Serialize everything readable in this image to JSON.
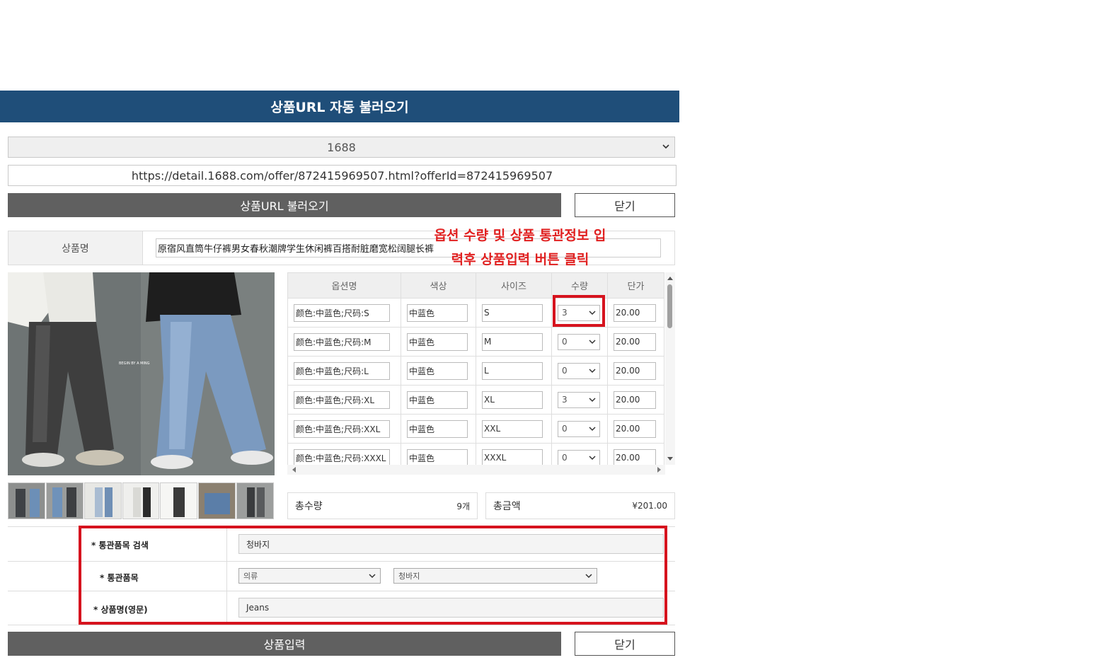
{
  "header": {
    "title": "상품URL 자동 불러오기"
  },
  "site_select": {
    "value": "1688"
  },
  "url_input": {
    "value": "https://detail.1688.com/offer/872415969507.html?offerId=872415969507"
  },
  "buttons": {
    "load": "상품URL 불러오기",
    "close": "닫기",
    "submit": "상품입력"
  },
  "product_name": {
    "label": "상품명",
    "value": "原宿风直筒牛仔裤男女春秋潮牌学生休闲裤百搭耐脏磨宽松阔腿长裤"
  },
  "annotation": {
    "line1": "옵션 수량 및 상품 통관정보 입",
    "line2": "력후 상품입력 버튼 클릭"
  },
  "options_table": {
    "headers": [
      "옵션명",
      "색상",
      "사이즈",
      "수량",
      "단가"
    ],
    "rows": [
      {
        "name": "颜色:中蓝色;尺码:S",
        "color": "中蓝色",
        "size": "S",
        "qty": "3",
        "price": "20.00"
      },
      {
        "name": "颜色:中蓝色;尺码:M",
        "color": "中蓝色",
        "size": "M",
        "qty": "0",
        "price": "20.00"
      },
      {
        "name": "颜色:中蓝色;尺码:L",
        "color": "中蓝色",
        "size": "L",
        "qty": "0",
        "price": "20.00"
      },
      {
        "name": "颜色:中蓝色;尺码:XL",
        "color": "中蓝色",
        "size": "XL",
        "qty": "3",
        "price": "20.00"
      },
      {
        "name": "颜色:中蓝色;尺码:XXL",
        "color": "中蓝色",
        "size": "XXL",
        "qty": "0",
        "price": "20.00"
      },
      {
        "name": "颜色:中蓝色;尺码:XXXL",
        "color": "中蓝色",
        "size": "XXXL",
        "qty": "0",
        "price": "20.00"
      }
    ]
  },
  "image_overlay_text": "BEGIN BY A MING",
  "summary": {
    "qty_label": "총수량",
    "qty_value": "9개",
    "amount_label": "총금액",
    "amount_value": "¥201.00"
  },
  "customs": {
    "search_label": "* 통관품목 검색",
    "search_value": "청바지",
    "item_label": "* 통관품목",
    "category_value": "의류",
    "subcategory_value": "청바지",
    "english_name_label": "* 상품명(영문)",
    "english_name_value": "Jeans"
  },
  "colors": {
    "header_bg": "#1f4e79",
    "button_dark": "#606060",
    "highlight_red": "#d6131e",
    "annotation_red": "#e02020"
  }
}
